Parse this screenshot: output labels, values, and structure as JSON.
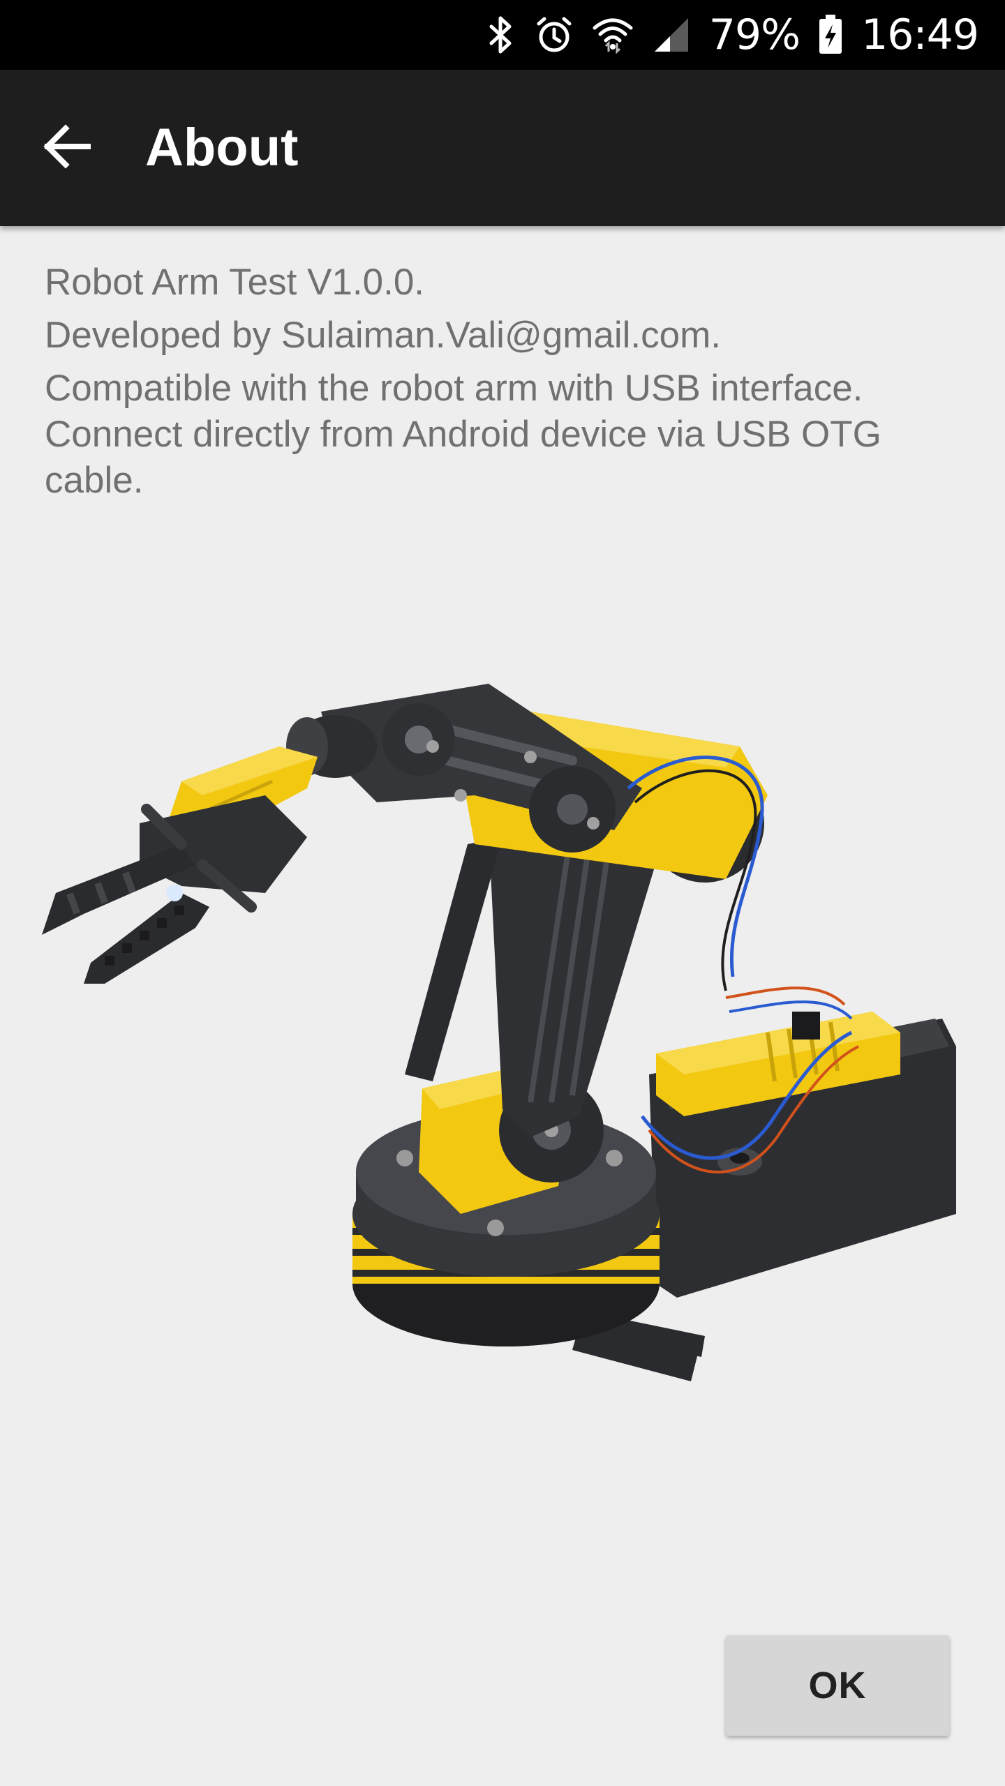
{
  "status_bar": {
    "battery_percent": "79%",
    "time": "16:49",
    "icons": [
      "bluetooth-icon",
      "alarm-icon",
      "wifi-icon",
      "cellular-signal-icon",
      "battery-charging-icon"
    ]
  },
  "app_bar": {
    "title": "About",
    "back_icon": "arrow-left-icon"
  },
  "content": {
    "version": "Robot Arm Test V1.0.0.",
    "developer": "Developed by Sulaiman.Vali@gmail.com.",
    "compatibility": "Compatible with the robot arm with USB interface.",
    "connection": "Connect directly from Android device via USB OTG cable."
  },
  "image": {
    "subject": "robot-arm-image",
    "colors": {
      "body": "#f2c811",
      "frame": "#2f3033"
    }
  },
  "dialog": {
    "ok_label": "OK"
  }
}
